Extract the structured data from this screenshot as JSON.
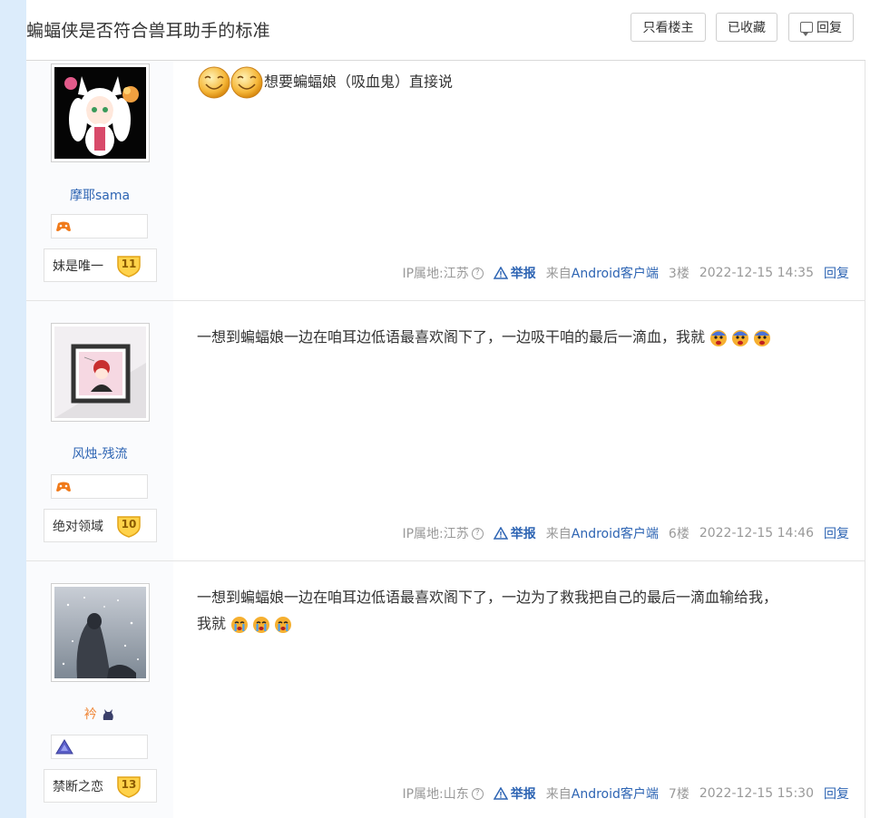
{
  "header": {
    "title": "蝙蝠侠是否符合兽耳助手的标准",
    "only_op_label": "只看楼主",
    "favorited_label": "已收藏",
    "reply_label": "回复"
  },
  "posts": [
    {
      "username": "摩耶sama",
      "badge_icon": "game-controller-badge-icon",
      "level_title": "妹是唯一",
      "level": "11",
      "content": "想要蝙蝠娘（吸血鬼）直接说",
      "ip": "IP属地:江苏",
      "report": "举报",
      "source_prefix": "来自",
      "source_client": "Android客户端",
      "floor": "3楼",
      "time": "2022-12-15 14:35",
      "reply": "回复"
    },
    {
      "username": "风烛-残流",
      "badge_icon": "game-controller-badge-icon",
      "level_title": "绝对领域",
      "level": "10",
      "content": "一想到蝙蝠娘一边在咱耳边低语最喜欢阁下了，一边吸干咱的最后一滴血，我就",
      "ip": "IP属地:江苏",
      "report": "举报",
      "source_prefix": "来自",
      "source_client": "Android客户端",
      "floor": "6楼",
      "time": "2022-12-15 14:46",
      "reply": "回复"
    },
    {
      "username": "衿",
      "badge_icon": "triangle-badge-icon",
      "level_title": "禁断之恋",
      "level": "13",
      "content_line1": "一想到蝙蝠娘一边在咱耳边低语最喜欢阁下了，一边为了救我把自己的最后一滴血输给我，",
      "content_line2": "我就",
      "ip": "IP属地:山东",
      "report": "举报",
      "source_prefix": "来自",
      "source_client": "Android客户端",
      "floor": "7楼",
      "time": "2022-12-15 15:30",
      "reply": "回复"
    }
  ],
  "colors": {
    "link_blue": "#2d64b3",
    "side_strip": "#dcecfb",
    "orange_name": "#f0883a"
  }
}
